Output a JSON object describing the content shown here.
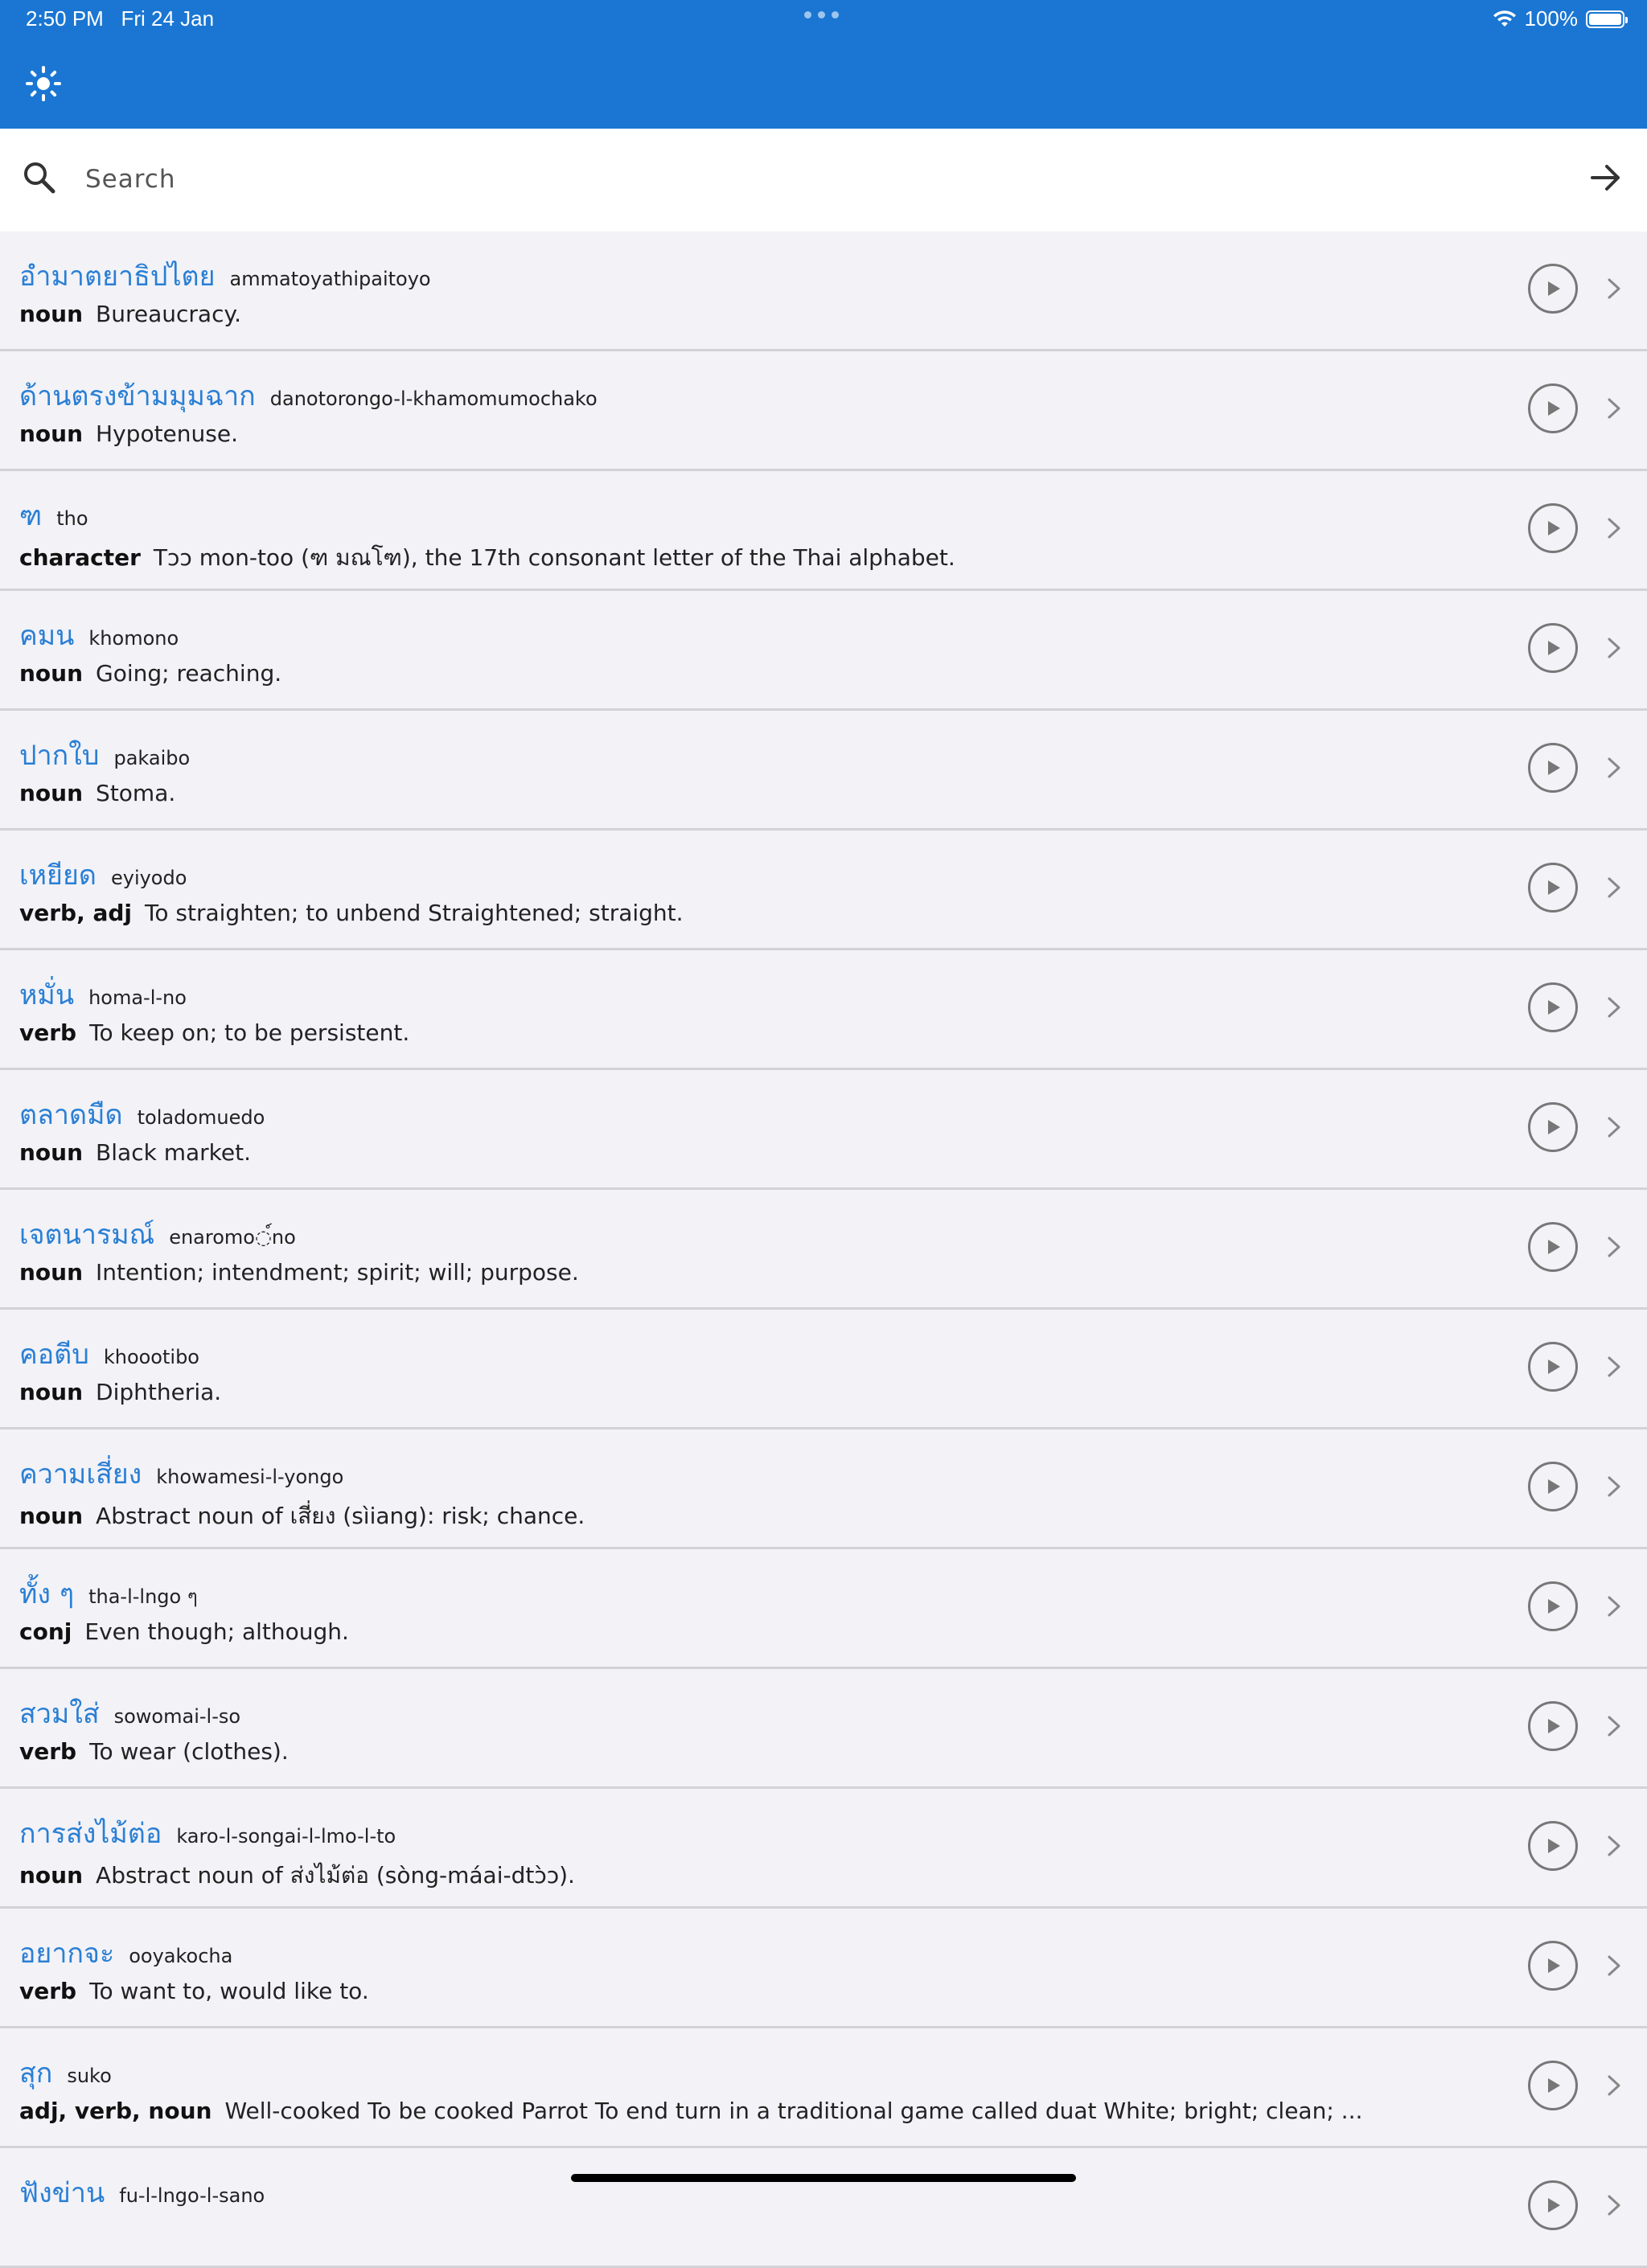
{
  "status": {
    "time": "2:50 PM",
    "date": "Fri 24 Jan",
    "battery": "100%",
    "battery_level": 1.0
  },
  "search": {
    "placeholder": "Search"
  },
  "entries": [
    {
      "thai": "อำมาตยาธิปไตย",
      "romanized": "ammatoyathipaitoyo",
      "pos": "noun",
      "definition": "Bureaucracy."
    },
    {
      "thai": "ด้านตรงข้ามมุมฉาก",
      "romanized": "danotorongo-l-khamomumochako",
      "pos": "noun",
      "definition": "Hypotenuse."
    },
    {
      "thai": "ฑ",
      "romanized": "tho",
      "pos": "character",
      "definition": "Tɔɔ mon-too (ฑ มณโฑ), the 17th consonant letter of the Thai alphabet."
    },
    {
      "thai": "คมน",
      "romanized": "khomono",
      "pos": "noun",
      "definition": "Going; reaching."
    },
    {
      "thai": "ปากใบ",
      "romanized": "pakaibo",
      "pos": "noun",
      "definition": "Stoma."
    },
    {
      "thai": "เหยียด",
      "romanized": "eyiyodo",
      "pos": "verb, adj",
      "definition": "To straighten; to unbend Straightened; straight."
    },
    {
      "thai": "หมั่น",
      "romanized": "homa-l-no",
      "pos": "verb",
      "definition": "To keep on; to be persistent."
    },
    {
      "thai": "ตลาดมืด",
      "romanized": "toladomuedo",
      "pos": "noun",
      "definition": "Black market."
    },
    {
      "thai": "เจตนารมณ์",
      "romanized": "enaromo◌์no",
      "pos": "noun",
      "definition": "Intention; intendment; spirit; will; purpose."
    },
    {
      "thai": "คอตีบ",
      "romanized": "khoootibo",
      "pos": "noun",
      "definition": "Diphtheria."
    },
    {
      "thai": "ความเสี่ยง",
      "romanized": "khowamesi-l-yongo",
      "pos": "noun",
      "definition": "Abstract noun of เสี่ยง (sìiang): risk; chance."
    },
    {
      "thai": "ทั้ง ๆ",
      "romanized": "tha-l-lngo ๆ",
      "pos": "conj",
      "definition": "Even though; although."
    },
    {
      "thai": "สวมใส่",
      "romanized": "sowomai-l-so",
      "pos": "verb",
      "definition": "To wear (clothes)."
    },
    {
      "thai": "การส่งไม้ต่อ",
      "romanized": "karo-l-songai-l-lmo-l-to",
      "pos": "noun",
      "definition": "Abstract noun of ส่งไม้ต่อ (sòng-máai-dtɔ̀ɔ)."
    },
    {
      "thai": "อยากจะ",
      "romanized": "ooyakocha",
      "pos": "verb",
      "definition": "To want to, would like to."
    },
    {
      "thai": "สุก",
      "romanized": "suko",
      "pos": "adj, verb, noun",
      "definition": "Well-cooked To be cooked Parrot To end turn in a traditional game called duat White; bright; clean; ..."
    },
    {
      "thai": "ฟังข่าน",
      "romanized": "fu-l-lngo-l-sano",
      "pos": "",
      "definition": ""
    }
  ]
}
